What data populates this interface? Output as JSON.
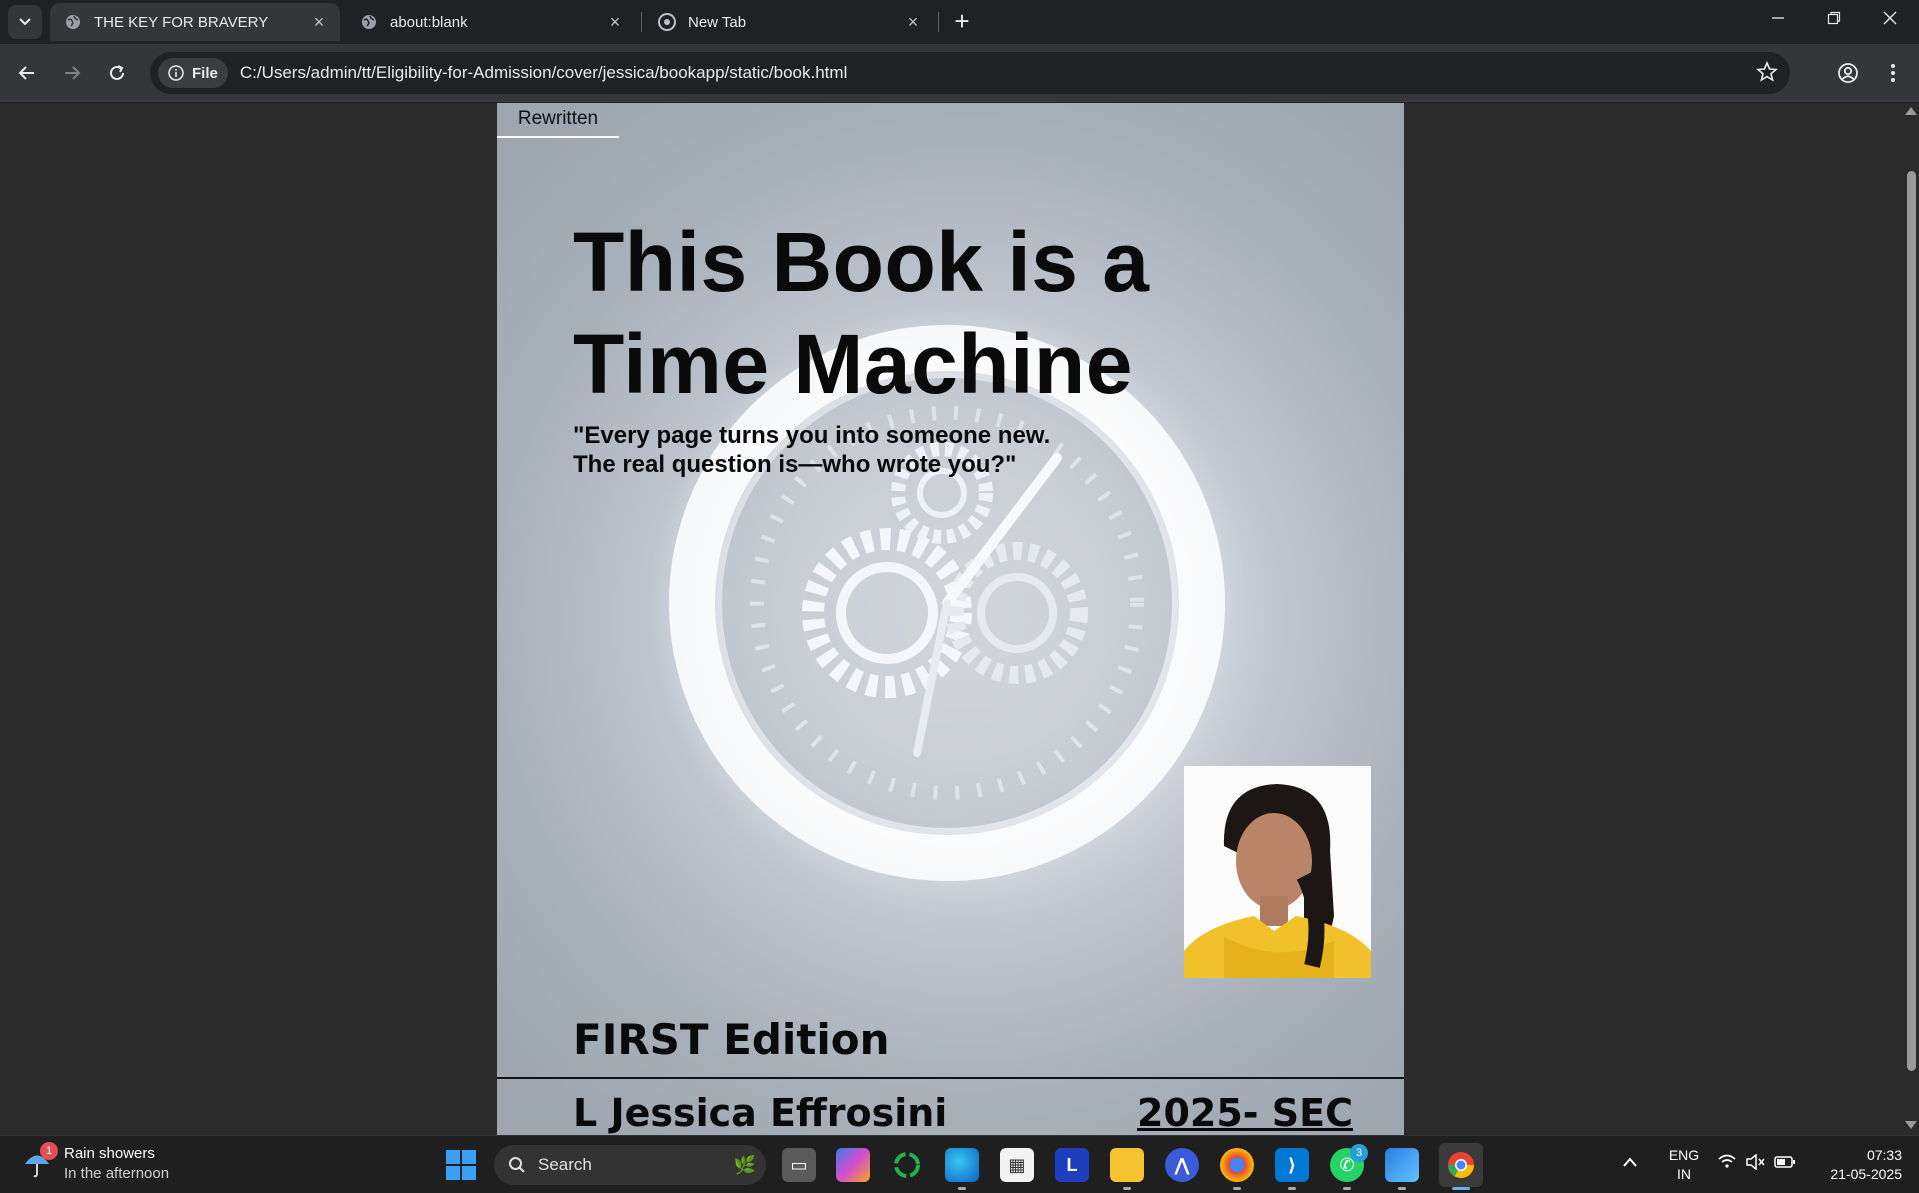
{
  "browser": {
    "tabs": [
      {
        "title": "THE KEY FOR BRAVERY",
        "active": true
      },
      {
        "title": "about:blank",
        "active": false
      },
      {
        "title": "New Tab",
        "active": false
      }
    ],
    "site_chip": "File",
    "url": "C:/Users/admin/tt/Eligibility-for-Admission/cover/jessica/bookapp/static/book.html"
  },
  "page": {
    "nav_tab_label": "Rewritten",
    "headline_line1": "This Book is a",
    "headline_line2": "Time Machine",
    "quote_line1": "\"Every page turns you into someone new.",
    "quote_line2": "The real question is—who wrote you?\"",
    "edition": "FIRST Edition",
    "author": "L Jessica Effrosini",
    "year": "2025- SEC"
  },
  "taskbar": {
    "weather_title": "Rain showers",
    "weather_subtitle": "In the afternoon",
    "weather_badge": "1",
    "search_placeholder": "Search",
    "whatsapp_badge": "3",
    "language_line1": "ENG",
    "language_line2": "IN",
    "time": "07:33",
    "date": "21-05-2025"
  },
  "colors": {
    "browser_frame": "#202124",
    "toolbar": "#35363a",
    "page_background": "#2b2b2b",
    "accent_blue": "#3aa0f5"
  }
}
